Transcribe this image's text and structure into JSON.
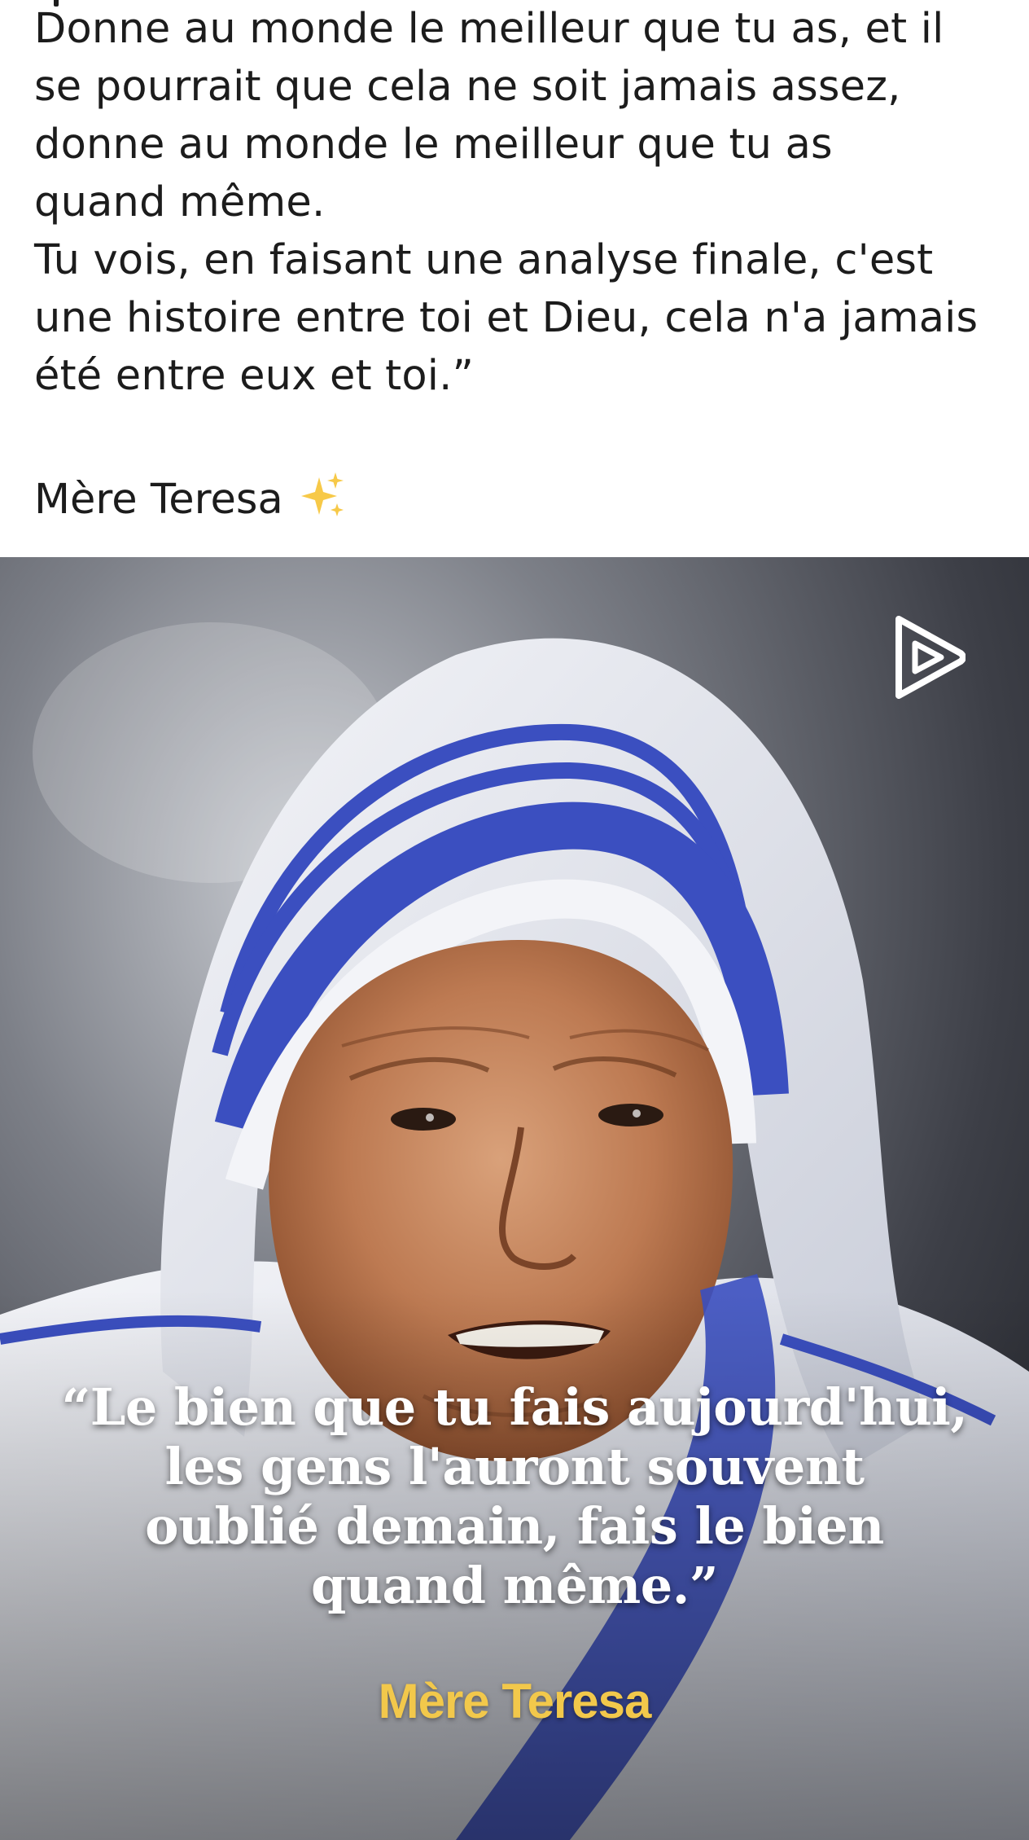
{
  "post": {
    "lines": [
      "Donne au monde le meilleur que tu as, et il",
      "se pourrait que cela ne soit jamais assez,",
      "donne au monde le meilleur que tu as",
      "quand même.",
      "Tu vois, en faisant une analyse finale, c'est",
      "une histoire entre toi et Dieu, cela n'a jamais",
      "été entre eux et toi.”"
    ],
    "signature": "Mère Teresa",
    "signature_emoji": "sparkles-icon"
  },
  "image": {
    "overlay_icon": "video-play-icon",
    "quote_lines": [
      "“Le bien que tu fais aujourd'hui,",
      "les gens l'auront souvent",
      "oublié demain, fais le bien",
      "quand même.”"
    ],
    "author": "Mère Teresa",
    "colors": {
      "quote_text": "#ffffff",
      "author_text": "#f2c84b",
      "veil_stripe": "#3b4fc0"
    }
  }
}
